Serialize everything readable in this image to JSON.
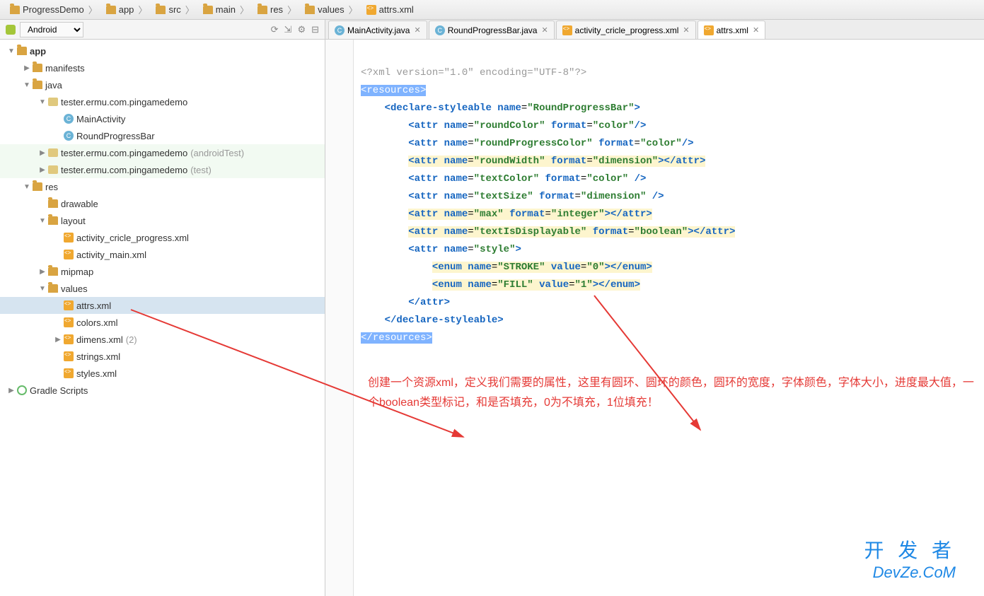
{
  "breadcrumbs": [
    "ProgressDemo",
    "app",
    "src",
    "main",
    "res",
    "values",
    "attrs.xml"
  ],
  "sidebar": {
    "selector": "Android",
    "toolbar_icons": [
      "sync",
      "collapse",
      "settings",
      "hide"
    ]
  },
  "tree": [
    {
      "d": 0,
      "exp": "▼",
      "icon": "folder",
      "label": "app",
      "bold": true
    },
    {
      "d": 1,
      "exp": "▶",
      "icon": "folder",
      "label": "manifests"
    },
    {
      "d": 1,
      "exp": "▼",
      "icon": "folder",
      "label": "java"
    },
    {
      "d": 2,
      "exp": "▼",
      "icon": "pkg",
      "label": "tester.ermu.com.pingamedemo"
    },
    {
      "d": 3,
      "exp": "",
      "icon": "java",
      "label": "MainActivity"
    },
    {
      "d": 3,
      "exp": "",
      "icon": "java",
      "label": "RoundProgressBar"
    },
    {
      "d": 2,
      "exp": "▶",
      "icon": "pkg",
      "label": "tester.ermu.com.pingamedemo",
      "suffix": "(androidTest)",
      "tint": true
    },
    {
      "d": 2,
      "exp": "▶",
      "icon": "pkg",
      "label": "tester.ermu.com.pingamedemo",
      "suffix": "(test)",
      "tint": true
    },
    {
      "d": 1,
      "exp": "▼",
      "icon": "folder",
      "label": "res"
    },
    {
      "d": 2,
      "exp": "",
      "icon": "folder",
      "label": "drawable"
    },
    {
      "d": 2,
      "exp": "▼",
      "icon": "folder",
      "label": "layout"
    },
    {
      "d": 3,
      "exp": "",
      "icon": "xml",
      "label": "activity_cricle_progress.xml"
    },
    {
      "d": 3,
      "exp": "",
      "icon": "xml",
      "label": "activity_main.xml"
    },
    {
      "d": 2,
      "exp": "▶",
      "icon": "folder",
      "label": "mipmap"
    },
    {
      "d": 2,
      "exp": "▼",
      "icon": "folder",
      "label": "values"
    },
    {
      "d": 3,
      "exp": "",
      "icon": "xml",
      "label": "attrs.xml",
      "selected": true
    },
    {
      "d": 3,
      "exp": "",
      "icon": "xml",
      "label": "colors.xml"
    },
    {
      "d": 3,
      "exp": "▶",
      "icon": "xml",
      "label": "dimens.xml",
      "suffix": "(2)"
    },
    {
      "d": 3,
      "exp": "",
      "icon": "xml",
      "label": "strings.xml"
    },
    {
      "d": 3,
      "exp": "",
      "icon": "xml",
      "label": "styles.xml"
    },
    {
      "d": 0,
      "exp": "▶",
      "icon": "gradle",
      "label": "Gradle Scripts"
    }
  ],
  "tabs": [
    {
      "icon": "java",
      "label": "MainActivity.java",
      "active": false
    },
    {
      "icon": "java",
      "label": "RoundProgressBar.java",
      "active": false
    },
    {
      "icon": "xml",
      "label": "activity_cricle_progress.xml",
      "active": false
    },
    {
      "icon": "xml",
      "label": "attrs.xml",
      "active": true
    }
  ],
  "code": {
    "l1_pi": "<?xml version=\"1.0\" encoding=\"UTF-8\"?>",
    "l2_open": "resources",
    "l3_tag": "declare-styleable",
    "l3_name": "RoundProgressBar",
    "l4_name": "roundColor",
    "l4_fmt": "color",
    "l5_name": "roundProgressColor",
    "l5_fmt": "color",
    "l6_name": "roundWidth",
    "l6_fmt": "dimension",
    "l7_name": "textColor",
    "l7_fmt": "color",
    "l8_name": "textSize",
    "l8_fmt": "dimension",
    "l9_name": "max",
    "l9_fmt": "integer",
    "l10_name": "textIsDisplayable",
    "l10_fmt": "boolean",
    "l11_name": "style",
    "l12_name": "STROKE",
    "l12_val": "0",
    "l13_name": "FILL",
    "l13_val": "1",
    "attr": "attr",
    "enum": "enum",
    "name_k": "name",
    "format_k": "format",
    "value_k": "value"
  },
  "annotation": "创建一个资源xml，定义我们需要的属性，这里有圆环、圆环的颜色，圆环的宽度，字体颜色，字体大小，进度最大值，一个boolean类型标记，和是否填充，0为不填充，1位填充！",
  "watermark": {
    "cn": "开 发 者",
    "en": "DevZe.CoM"
  }
}
